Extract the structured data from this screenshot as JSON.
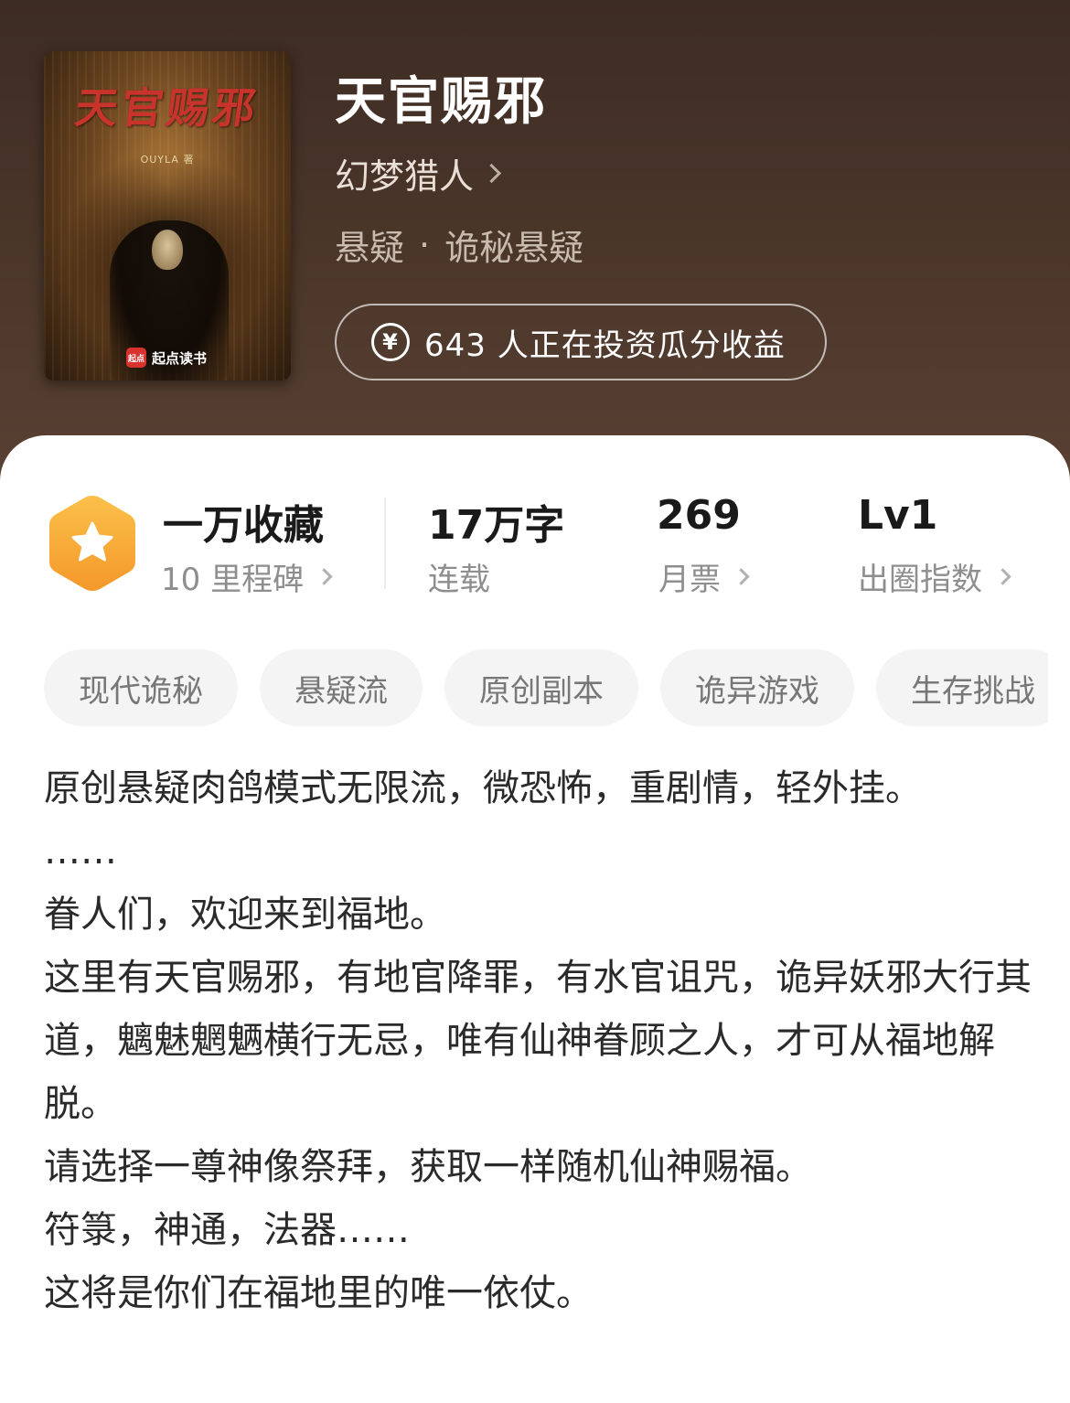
{
  "book": {
    "cover": {
      "title": "天官赐邪",
      "author_small": "OUYLA 著",
      "brand": "起点读书",
      "brand_logo": "起点"
    },
    "title": "天官赐邪",
    "author": "幻梦猎人",
    "genre": "悬疑",
    "separator": "·",
    "subgenre": "诡秘悬疑",
    "invest_text": "643 人正在投资瓜分收益",
    "invest_icon": "yen-icon"
  },
  "stats": {
    "collection": {
      "value": "一万收藏",
      "label": "10 里程碑"
    },
    "words": {
      "value": "17万字",
      "label": "连载"
    },
    "monthly_votes": {
      "value": "269",
      "label": "月票"
    },
    "popularity": {
      "value": "Lv1",
      "label": "出圈指数"
    }
  },
  "tags": [
    "现代诡秘",
    "悬疑流",
    "原创副本",
    "诡异游戏",
    "生存挑战"
  ],
  "synopsis": [
    "原创悬疑肉鸽模式无限流，微恐怖，重剧情，轻外挂。",
    "……",
    "眷人们，欢迎来到福地。",
    "这里有天官赐邪，有地官降罪，有水官诅咒，诡异妖邪大行其道，魑魅魍魉横行无忌，唯有仙神眷顾之人，才可从福地解脱。",
    "请选择一尊神像祭拜，获取一样随机仙神赐福。",
    "符箓，神通，法器……",
    "这将是你们在福地里的唯一依仗。"
  ],
  "colors": {
    "hero_bg": "#3d2c24",
    "badge_orange": "#f7a92a",
    "accent_white": "#ffffff"
  }
}
